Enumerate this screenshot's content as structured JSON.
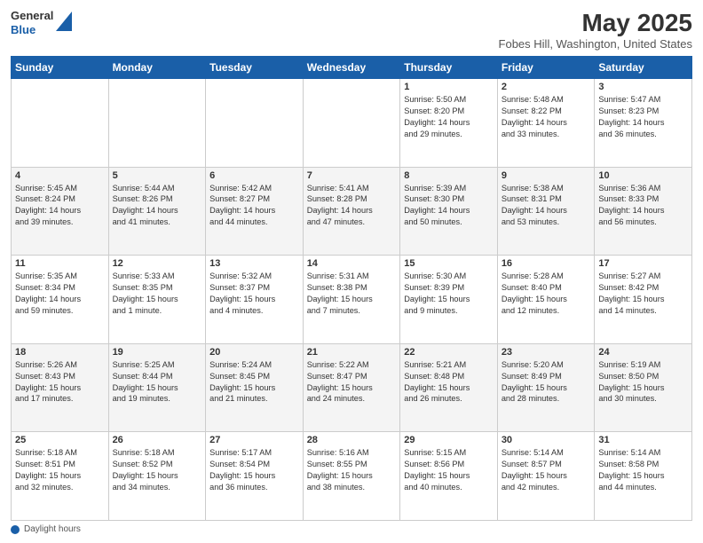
{
  "header": {
    "logo_general": "General",
    "logo_blue": "Blue",
    "month_title": "May 2025",
    "location": "Fobes Hill, Washington, United States"
  },
  "days_of_week": [
    "Sunday",
    "Monday",
    "Tuesday",
    "Wednesday",
    "Thursday",
    "Friday",
    "Saturday"
  ],
  "footer": {
    "label": "Daylight hours"
  },
  "weeks": [
    [
      {
        "day": "",
        "info": ""
      },
      {
        "day": "",
        "info": ""
      },
      {
        "day": "",
        "info": ""
      },
      {
        "day": "",
        "info": ""
      },
      {
        "day": "1",
        "info": "Sunrise: 5:50 AM\nSunset: 8:20 PM\nDaylight: 14 hours\nand 29 minutes."
      },
      {
        "day": "2",
        "info": "Sunrise: 5:48 AM\nSunset: 8:22 PM\nDaylight: 14 hours\nand 33 minutes."
      },
      {
        "day": "3",
        "info": "Sunrise: 5:47 AM\nSunset: 8:23 PM\nDaylight: 14 hours\nand 36 minutes."
      }
    ],
    [
      {
        "day": "4",
        "info": "Sunrise: 5:45 AM\nSunset: 8:24 PM\nDaylight: 14 hours\nand 39 minutes."
      },
      {
        "day": "5",
        "info": "Sunrise: 5:44 AM\nSunset: 8:26 PM\nDaylight: 14 hours\nand 41 minutes."
      },
      {
        "day": "6",
        "info": "Sunrise: 5:42 AM\nSunset: 8:27 PM\nDaylight: 14 hours\nand 44 minutes."
      },
      {
        "day": "7",
        "info": "Sunrise: 5:41 AM\nSunset: 8:28 PM\nDaylight: 14 hours\nand 47 minutes."
      },
      {
        "day": "8",
        "info": "Sunrise: 5:39 AM\nSunset: 8:30 PM\nDaylight: 14 hours\nand 50 minutes."
      },
      {
        "day": "9",
        "info": "Sunrise: 5:38 AM\nSunset: 8:31 PM\nDaylight: 14 hours\nand 53 minutes."
      },
      {
        "day": "10",
        "info": "Sunrise: 5:36 AM\nSunset: 8:33 PM\nDaylight: 14 hours\nand 56 minutes."
      }
    ],
    [
      {
        "day": "11",
        "info": "Sunrise: 5:35 AM\nSunset: 8:34 PM\nDaylight: 14 hours\nand 59 minutes."
      },
      {
        "day": "12",
        "info": "Sunrise: 5:33 AM\nSunset: 8:35 PM\nDaylight: 15 hours\nand 1 minute."
      },
      {
        "day": "13",
        "info": "Sunrise: 5:32 AM\nSunset: 8:37 PM\nDaylight: 15 hours\nand 4 minutes."
      },
      {
        "day": "14",
        "info": "Sunrise: 5:31 AM\nSunset: 8:38 PM\nDaylight: 15 hours\nand 7 minutes."
      },
      {
        "day": "15",
        "info": "Sunrise: 5:30 AM\nSunset: 8:39 PM\nDaylight: 15 hours\nand 9 minutes."
      },
      {
        "day": "16",
        "info": "Sunrise: 5:28 AM\nSunset: 8:40 PM\nDaylight: 15 hours\nand 12 minutes."
      },
      {
        "day": "17",
        "info": "Sunrise: 5:27 AM\nSunset: 8:42 PM\nDaylight: 15 hours\nand 14 minutes."
      }
    ],
    [
      {
        "day": "18",
        "info": "Sunrise: 5:26 AM\nSunset: 8:43 PM\nDaylight: 15 hours\nand 17 minutes."
      },
      {
        "day": "19",
        "info": "Sunrise: 5:25 AM\nSunset: 8:44 PM\nDaylight: 15 hours\nand 19 minutes."
      },
      {
        "day": "20",
        "info": "Sunrise: 5:24 AM\nSunset: 8:45 PM\nDaylight: 15 hours\nand 21 minutes."
      },
      {
        "day": "21",
        "info": "Sunrise: 5:22 AM\nSunset: 8:47 PM\nDaylight: 15 hours\nand 24 minutes."
      },
      {
        "day": "22",
        "info": "Sunrise: 5:21 AM\nSunset: 8:48 PM\nDaylight: 15 hours\nand 26 minutes."
      },
      {
        "day": "23",
        "info": "Sunrise: 5:20 AM\nSunset: 8:49 PM\nDaylight: 15 hours\nand 28 minutes."
      },
      {
        "day": "24",
        "info": "Sunrise: 5:19 AM\nSunset: 8:50 PM\nDaylight: 15 hours\nand 30 minutes."
      }
    ],
    [
      {
        "day": "25",
        "info": "Sunrise: 5:18 AM\nSunset: 8:51 PM\nDaylight: 15 hours\nand 32 minutes."
      },
      {
        "day": "26",
        "info": "Sunrise: 5:18 AM\nSunset: 8:52 PM\nDaylight: 15 hours\nand 34 minutes."
      },
      {
        "day": "27",
        "info": "Sunrise: 5:17 AM\nSunset: 8:54 PM\nDaylight: 15 hours\nand 36 minutes."
      },
      {
        "day": "28",
        "info": "Sunrise: 5:16 AM\nSunset: 8:55 PM\nDaylight: 15 hours\nand 38 minutes."
      },
      {
        "day": "29",
        "info": "Sunrise: 5:15 AM\nSunset: 8:56 PM\nDaylight: 15 hours\nand 40 minutes."
      },
      {
        "day": "30",
        "info": "Sunrise: 5:14 AM\nSunset: 8:57 PM\nDaylight: 15 hours\nand 42 minutes."
      },
      {
        "day": "31",
        "info": "Sunrise: 5:14 AM\nSunset: 8:58 PM\nDaylight: 15 hours\nand 44 minutes."
      }
    ]
  ]
}
